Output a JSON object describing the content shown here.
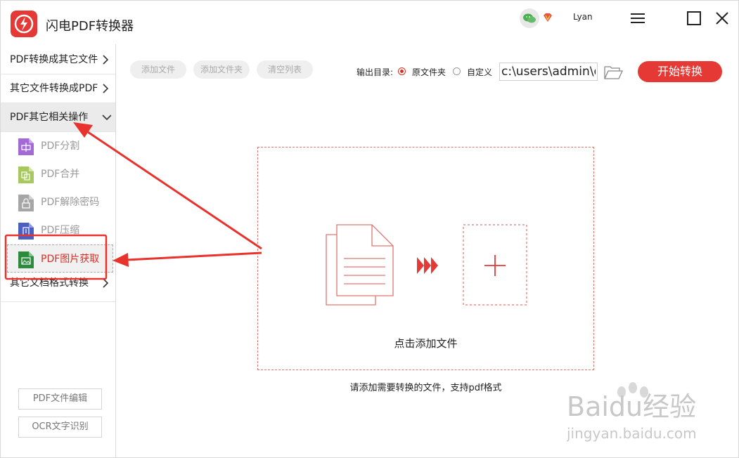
{
  "app": {
    "title": "闪电PDF转换器",
    "username": "Lyan"
  },
  "sidebar": {
    "categories": [
      {
        "label": "PDF转换成其它文件"
      },
      {
        "label": "其它文件转换成PDF"
      },
      {
        "label": "PDF其它相关操作"
      },
      {
        "label": "其它文档格式转换"
      }
    ],
    "subitems": [
      {
        "label": "PDF分割",
        "color": "#a36ad6",
        "icon": "split-icon"
      },
      {
        "label": "PDF合并",
        "color": "#a8c85e",
        "icon": "merge-icon"
      },
      {
        "label": "PDF解除密码",
        "color": "#a6a6a6",
        "icon": "unlock-icon"
      },
      {
        "label": "PDF压缩",
        "color": "#4a5fc1",
        "icon": "compress-icon"
      },
      {
        "label": "PDF图片获取",
        "color": "#2e8b3e",
        "icon": "image-icon"
      }
    ],
    "bottom_buttons": [
      {
        "label": "PDF文件编辑"
      },
      {
        "label": "OCR文字识别"
      }
    ]
  },
  "toolbar": {
    "add_file": "添加文件",
    "add_folder": "添加文件夹",
    "clear_list": "清空列表",
    "output_label": "输出目录:",
    "option_original": "原文件夹",
    "option_custom": "自定义",
    "output_path": "c:\\users\\admin\\d",
    "start": "开始转换"
  },
  "dropzone": {
    "text": "点击添加文件",
    "hint": "请添加需要转换的文件，支持pdf格式"
  },
  "watermark": {
    "brand": "Baidu经验",
    "url": "jingyan.baidu.com"
  },
  "colors": {
    "accent": "#e53935",
    "annotation": "#e8322c"
  }
}
